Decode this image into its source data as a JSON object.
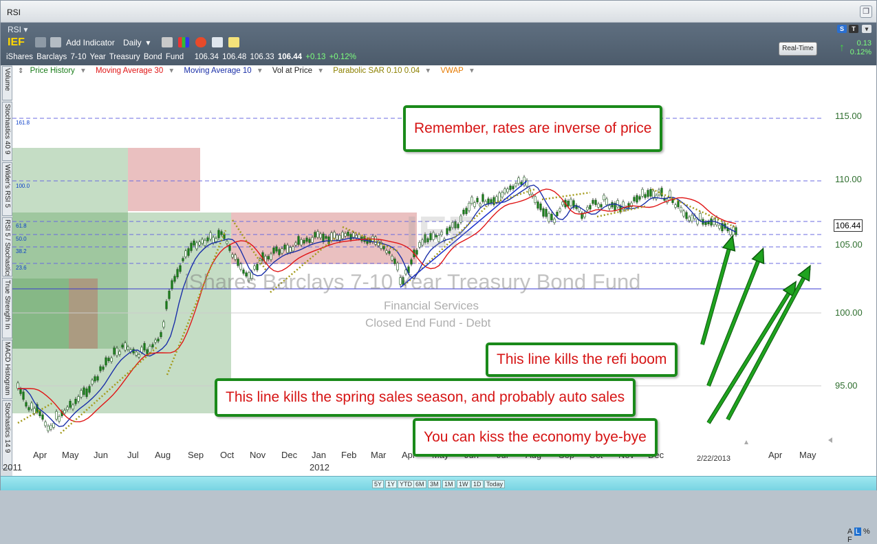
{
  "window": {
    "title": "RSI"
  },
  "toolbar": {
    "template_menu": "RSI",
    "ticker": "IEF",
    "add_indicator": "Add Indicator",
    "period": "Daily",
    "realtime_button": "Real-Time",
    "realtime_change": "0.13",
    "realtime_change_pct": "0.12%"
  },
  "quote": {
    "name": "iShares Barclays 7-10 Year Treasury Bond Fund",
    "open": "106.34",
    "high": "106.48",
    "low": "106.33",
    "last": "106.44",
    "change": "+0.13",
    "change_pct": "+0.12%"
  },
  "legend": [
    {
      "label": "Price History",
      "color": "#1a7d1a"
    },
    {
      "label": "Moving Average 30",
      "color": "#e01515"
    },
    {
      "label": "Moving Average 10",
      "color": "#1a2fa8"
    },
    {
      "label": "Vol at Price",
      "color": "#222222"
    },
    {
      "label": "Parabolic SAR 0.10 0.04",
      "color": "#8c8000"
    },
    {
      "label": "VWAP",
      "color": "#e67a00"
    }
  ],
  "side_tabs": [
    "Volume",
    "Stochastics 40 9",
    "Wilder's RSI 5",
    "RSI 5 / Stochastics",
    "True Strength In",
    "MACD Histogram",
    "Stochastics 14 9"
  ],
  "watermark": {
    "symbol": "IEF",
    "name": "iShares Barclays 7-10 Year Treasury Bond Fund",
    "sector": "Financial Services",
    "industry": "Closed End Fund - Debt"
  },
  "y_axis": {
    "labels": [
      "115.00",
      "110.00",
      "105.00",
      "100.00",
      "95.00"
    ],
    "last_price": "106.44"
  },
  "fib_levels": [
    "161.8",
    "100.0",
    "61.8",
    "50.0",
    "38.2",
    "23.6"
  ],
  "x_axis": {
    "months": [
      "Apr",
      "May",
      "Jun",
      "Jul",
      "Aug",
      "Sep",
      "Oct",
      "Nov",
      "Dec",
      "Jan",
      "Feb",
      "Mar",
      "Apr",
      "May",
      "Jun",
      "Jul",
      "Aug",
      "Sep",
      "Oct",
      "Nov",
      "Dec",
      "Apr",
      "May"
    ],
    "years": [
      "2011",
      "2012"
    ],
    "cursor_date": "2/22/2013"
  },
  "annotations": [
    "Remember, rates are inverse of price",
    "This line kills the refi boom",
    "This line kills the spring sales season, and probably auto sales",
    "You can kiss the economy bye-bye"
  ],
  "periods": [
    "5Y",
    "1Y",
    "YTD",
    "6M",
    "3M",
    "1M",
    "1W",
    "1D",
    "Today"
  ],
  "scale_buttons": {
    "a": "A",
    "l": "L",
    "pct": "%",
    "f": "F"
  },
  "colors": {
    "price": "#1a7d1a",
    "ma30": "#e01515",
    "ma10": "#1a2fa8",
    "sar": "#a39a1a",
    "annotation_border": "#1a8a1a",
    "annotation_text": "#d61414"
  }
}
